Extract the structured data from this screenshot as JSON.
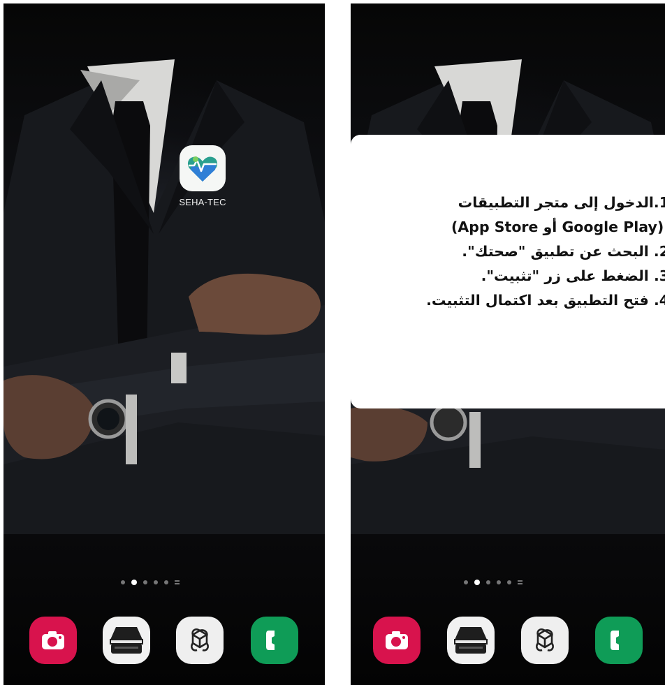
{
  "home_screen": {
    "app_icon": {
      "label": "SEHA-TEC",
      "icon": "seha-tec-heart-map-icon"
    },
    "page_indicator": {
      "pages": 5,
      "active_index": 1
    }
  },
  "dock": [
    {
      "app": "camera",
      "icon": "camera-icon",
      "color": "#d8134d"
    },
    {
      "app": "scanner",
      "icon": "scanner-icon",
      "color": "#f1f1f1"
    },
    {
      "app": "chatgpt",
      "icon": "openai-knot-icon",
      "color": "#efefef"
    },
    {
      "app": "phone",
      "icon": "phone-handset-icon",
      "color": "#0f9c57"
    }
  ],
  "instruction_card": {
    "steps": [
      "1.الدخول إلى متجر التطبيقات",
      "(App Store أو Google Play).",
      "2. البحث عن تطبيق \"صحتك\".",
      "3. الضغط على زر \"تثبيت\".",
      "4. فتح التطبيق بعد اكتمال التثبيت."
    ]
  }
}
